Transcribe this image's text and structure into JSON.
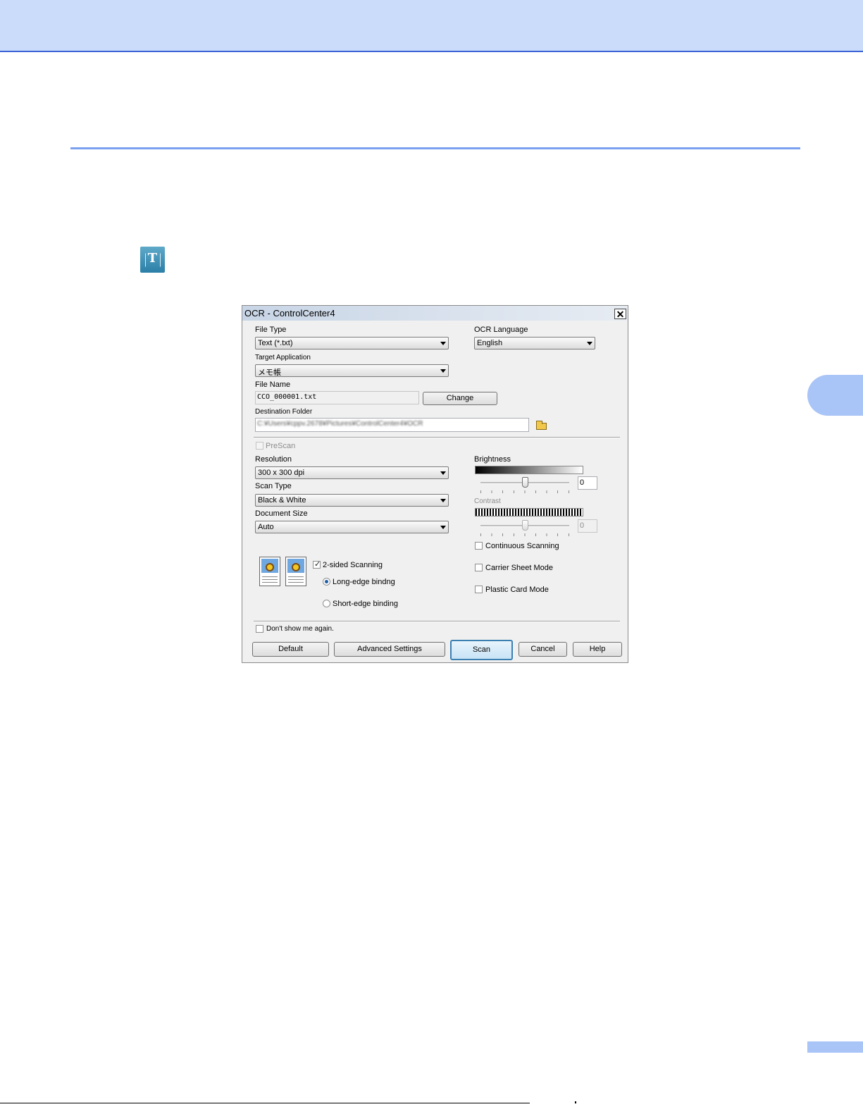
{
  "dialog": {
    "title": "OCR - ControlCenter4",
    "close_glyph": "✕",
    "file_type": {
      "label": "File Type",
      "value": "Text (*.txt)"
    },
    "ocr_language": {
      "label": "OCR Language",
      "value": "English"
    },
    "target_application": {
      "label": "Target Application",
      "value": "メモ帳"
    },
    "file_name": {
      "label": "File Name",
      "value": "CCO_000001.txt",
      "change_button": "Change"
    },
    "destination_folder": {
      "label": "Destination Folder",
      "value": "C:¥Users¥cppv.2678¥Pictures¥ControlCenter4¥OCR"
    },
    "prescan": {
      "label": "PreScan",
      "checked": false,
      "enabled": false
    },
    "resolution": {
      "label": "Resolution",
      "value": "300 x 300 dpi"
    },
    "scan_type": {
      "label": "Scan Type",
      "value": "Black & White"
    },
    "document_size": {
      "label": "Document Size",
      "value": "Auto"
    },
    "brightness": {
      "label": "Brightness",
      "value": "0",
      "level": 0.5
    },
    "contrast": {
      "label": "Contrast",
      "value": "0",
      "level": 0.5,
      "enabled": false
    },
    "continuous_scanning": {
      "label": "Continuous Scanning",
      "checked": false
    },
    "carrier_sheet_mode": {
      "label": "Carrier Sheet Mode",
      "checked": false
    },
    "plastic_card_mode": {
      "label": "Plastic Card Mode",
      "checked": false
    },
    "two_sided": {
      "label": "2-sided Scanning",
      "checked": true,
      "check_glyph": "✓"
    },
    "long_edge": {
      "label": "Long-edge bindng",
      "selected": true
    },
    "short_edge": {
      "label": "Short-edge binding",
      "selected": false
    },
    "dont_show": {
      "label": "Don't show me again.",
      "checked": false
    },
    "buttons": {
      "default": "Default",
      "advanced": "Advanced Settings",
      "scan": "Scan",
      "cancel": "Cancel",
      "help": "Help"
    }
  },
  "page_icon": {
    "letter": "T",
    "icon": "ocr-text-icon"
  },
  "colors": {
    "top_band": "#cbdcfb",
    "rule": "#7aa0f0",
    "tab": "#a9c4f7"
  }
}
